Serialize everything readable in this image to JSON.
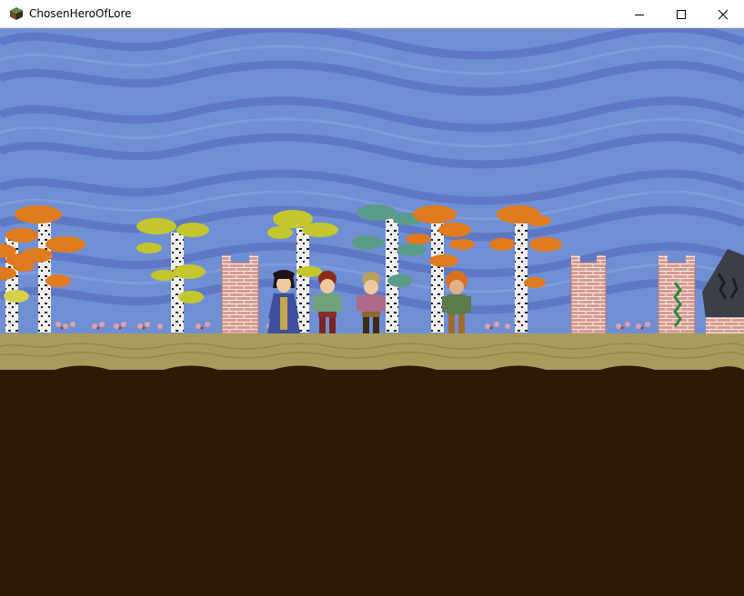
{
  "window": {
    "title": "ChosenHeroOfLore",
    "controls": {
      "minimize": "minimize-icon",
      "maximize": "maximize-icon",
      "close": "close-icon"
    }
  },
  "scene": {
    "sky_color": "#6f8fd4",
    "sky_wave_color": "#5d74c4",
    "grass_color": "#a89c5c",
    "soil_color": "#2e1a02",
    "trees": [
      {
        "kind": "orange-birch"
      },
      {
        "kind": "orange-birch"
      },
      {
        "kind": "yellow-birch"
      },
      {
        "kind": "yellow-birch"
      },
      {
        "kind": "teal-birch"
      },
      {
        "kind": "orange-birch"
      },
      {
        "kind": "orange-birch"
      }
    ],
    "towers": [
      {
        "kind": "brick-tower"
      },
      {
        "kind": "brick-tower"
      },
      {
        "kind": "brick-tower-vines"
      }
    ],
    "characters": [
      {
        "name": "robed-woman",
        "robe": "#3e4f9c",
        "hair": "#1c1418"
      },
      {
        "name": "redhead-boy",
        "shirt": "#6fa07a",
        "hair": "#8a2c1c"
      },
      {
        "name": "blond-boy",
        "shirt": "#b06a8a",
        "hair": "#b8a060"
      },
      {
        "name": "orange-hair-girl",
        "shirt": "#5c7a4a",
        "hair": "#d9701c"
      }
    ],
    "rune_stone": {
      "kind": "rune-stone"
    }
  }
}
